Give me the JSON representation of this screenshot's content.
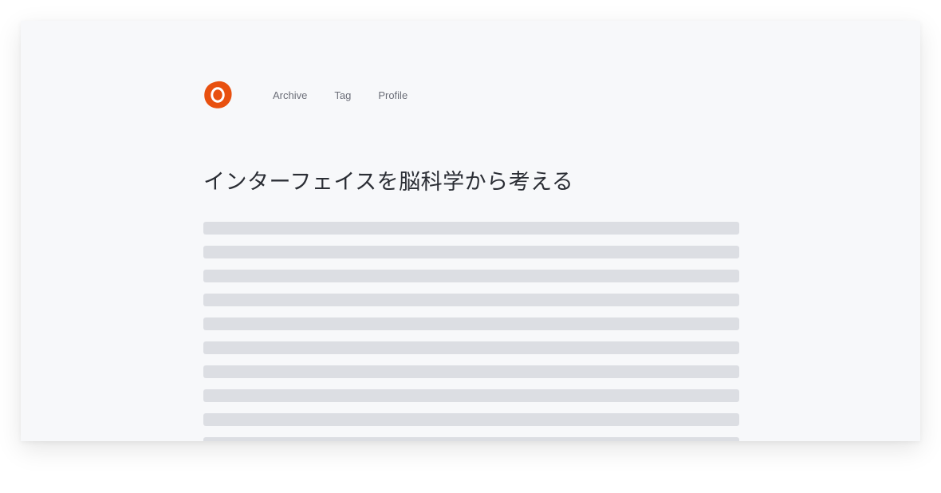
{
  "brand": {
    "logo_icon": "orange-ring-logo",
    "color": "#e8500f"
  },
  "nav": {
    "items": [
      {
        "label": "Archive"
      },
      {
        "label": "Tag"
      },
      {
        "label": "Profile"
      }
    ]
  },
  "article": {
    "title": "インターフェイスを脳科学から考える",
    "body_state": "loading-skeleton"
  }
}
